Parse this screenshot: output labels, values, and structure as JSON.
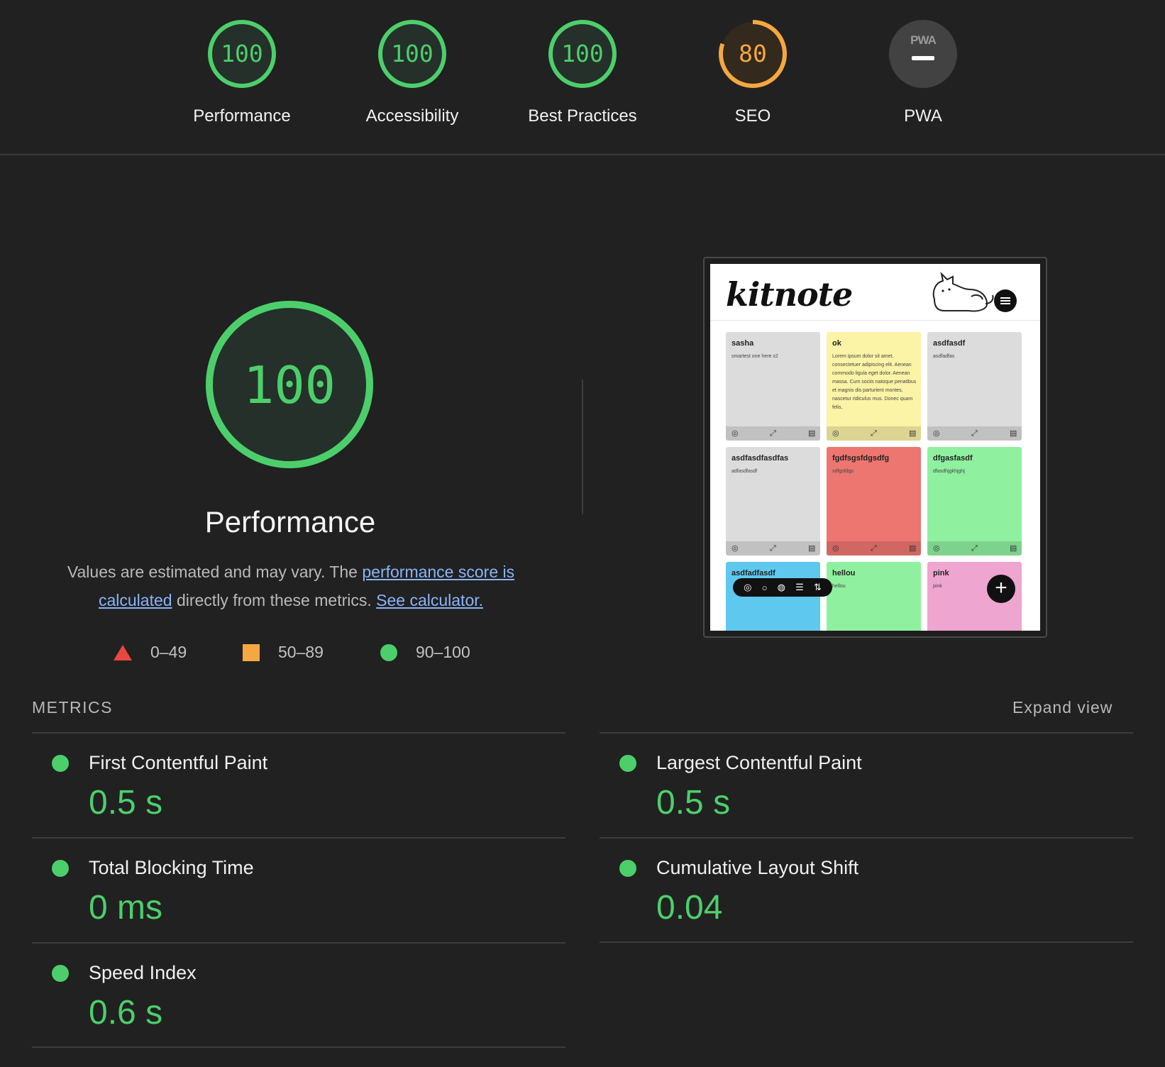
{
  "categories": [
    {
      "label": "Performance",
      "score": "100",
      "value": 100,
      "color": "#4ccf6b"
    },
    {
      "label": "Accessibility",
      "score": "100",
      "value": 100,
      "color": "#4ccf6b"
    },
    {
      "label": "Best Practices",
      "score": "100",
      "value": 100,
      "color": "#4ccf6b"
    },
    {
      "label": "SEO",
      "score": "80",
      "value": 80,
      "color": "#f5a742"
    },
    {
      "label": "PWA",
      "badge": "PWA",
      "color": "#9a9a9a"
    }
  ],
  "performance": {
    "score": "100",
    "value": 100,
    "title": "Performance",
    "desc_before": "Values are estimated and may vary. The ",
    "link1": "performance score is calculated",
    "desc_middle": " directly from these metrics. ",
    "link2": "See calculator."
  },
  "legend": [
    {
      "shape": "triangle",
      "range": "0–49",
      "color": "#e8483f"
    },
    {
      "shape": "square",
      "range": "50–89",
      "color": "#f5a742"
    },
    {
      "shape": "circle",
      "range": "90–100",
      "color": "#4ccf6b"
    }
  ],
  "screenshot": {
    "app_logo": "kitnote",
    "notes": [
      {
        "title": "sasha",
        "body": "smartest one here x2",
        "color": "#dcdcdc"
      },
      {
        "title": "ok",
        "body": "Lorem ipsum dolor sit amet, consectetuer adipiscing elit. Aenean commodo ligula eget dolor. Aenean massa. Cum sociis natoque penatibus et magnis dis parturient montes, nascetur ridiculus mus. Donec quam felis,",
        "color": "#fbf3a5"
      },
      {
        "title": "asdfasdf",
        "body": "asdfadfas",
        "color": "#dcdcdc"
      },
      {
        "title": "asdfasdfasdfas",
        "body": "adfasdfasdf",
        "color": "#dcdcdc"
      },
      {
        "title": "fgdfsgsfdgsdfg",
        "body": "sdfgsfdgs",
        "color": "#ed7670"
      },
      {
        "title": "dfgasfasdf",
        "body": "dfasdhjgkhjghj",
        "color": "#8ff19f"
      },
      {
        "title": "asdfadfasdf",
        "body": "",
        "color": "#5ec8ee"
      },
      {
        "title": "hellou",
        "body": "hellou",
        "color": "#8ff19f"
      },
      {
        "title": "pink",
        "body": "pink",
        "color": "#eea5d0"
      }
    ]
  },
  "metrics": {
    "header": "METRICS",
    "expand": "Expand view",
    "items": [
      {
        "name": "First Contentful Paint",
        "value": "0.5 s"
      },
      {
        "name": "Largest Contentful Paint",
        "value": "0.5 s"
      },
      {
        "name": "Total Blocking Time",
        "value": "0 ms"
      },
      {
        "name": "Cumulative Layout Shift",
        "value": "0.04"
      },
      {
        "name": "Speed Index",
        "value": "0.6 s"
      }
    ]
  }
}
